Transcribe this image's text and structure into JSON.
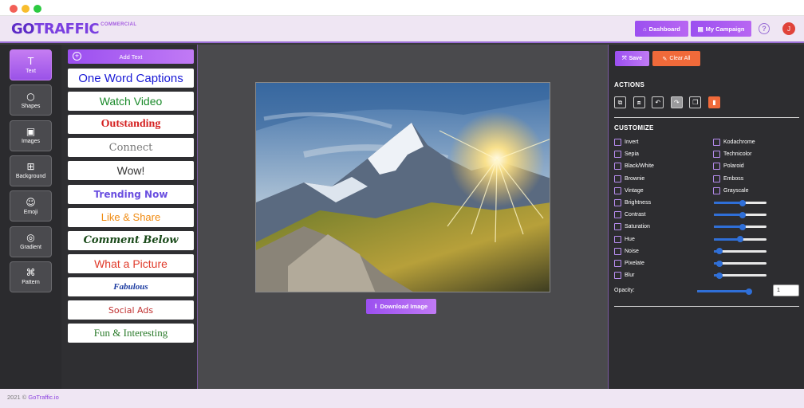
{
  "header": {
    "logo_go": "GO",
    "logo_main": "TRAFFIC",
    "logo_sub": "COMMERCIAL",
    "dashboard_label": "Dashboard",
    "campaign_label": "My Campaign",
    "help_glyph": "?",
    "avatar_initial": "J"
  },
  "tools": [
    {
      "label": "Text",
      "icon": "T"
    },
    {
      "label": "Shapes",
      "icon": "○"
    },
    {
      "label": "Images",
      "icon": "▣"
    },
    {
      "label": "Background",
      "icon": "⊞"
    },
    {
      "label": "Emoji",
      "icon": "☺"
    },
    {
      "label": "Gradient",
      "icon": "◎"
    },
    {
      "label": "Pattern",
      "icon": "⌘"
    }
  ],
  "text_panel": {
    "add_label": "Add Text",
    "styles": [
      {
        "label": "One Word Captions",
        "color": "#1a1ad6"
      },
      {
        "label": "Watch Video",
        "color": "#1a8a2a"
      },
      {
        "label": "Outstanding",
        "color": "#d42020"
      },
      {
        "label": "Connect",
        "color": "#777777"
      },
      {
        "label": "Wow!",
        "color": "#333333"
      },
      {
        "label": "Trending Now",
        "color": "#6a4fe0"
      },
      {
        "label": "Like & Share",
        "color": "#f08a10"
      },
      {
        "label": "Comment Below",
        "color": "#1a4a1a"
      },
      {
        "label": "What a Picture",
        "color": "#e03a2a"
      },
      {
        "label": "Fabulous",
        "color": "#1a3aa0"
      },
      {
        "label": "Social Ads",
        "color": "#c03030"
      },
      {
        "label": "Fun & Interesting",
        "color": "#2a7a2a"
      }
    ]
  },
  "canvas": {
    "download_label": "Download Image"
  },
  "right_panel": {
    "save_label": "Save",
    "clear_label": "Clear All",
    "actions_title": "ACTIONS",
    "actions": [
      "copy-icon",
      "paste-icon",
      "undo-icon",
      "redo-icon",
      "duplicate-icon",
      "delete-icon"
    ],
    "customize_title": "CUSTOMIZE",
    "filters_left": [
      "Invert",
      "Sepia",
      "Black/White",
      "Brownie",
      "Vintage"
    ],
    "filters_right": [
      "Kodachrome",
      "Technicolor",
      "Polaroid",
      "Emboss",
      "Grayscale"
    ],
    "adjustments": [
      {
        "label": "Brightness",
        "value": 0.55
      },
      {
        "label": "Contrast",
        "value": 0.55
      },
      {
        "label": "Saturation",
        "value": 0.55
      },
      {
        "label": "Hue",
        "value": 0.5
      },
      {
        "label": "Noise",
        "value": 0.1
      },
      {
        "label": "Pixelate",
        "value": 0.1
      },
      {
        "label": "Blur",
        "value": 0.1
      }
    ],
    "opacity_label": "Opacity:",
    "opacity_value": "1",
    "opacity_level": 0.95
  },
  "footer": {
    "copyright": "2021 ©",
    "brand": "GoTraffic.io"
  },
  "colors": {
    "accent": "#9b4ff0",
    "danger": "#f06a3a",
    "slider": "#2f6fd8"
  }
}
